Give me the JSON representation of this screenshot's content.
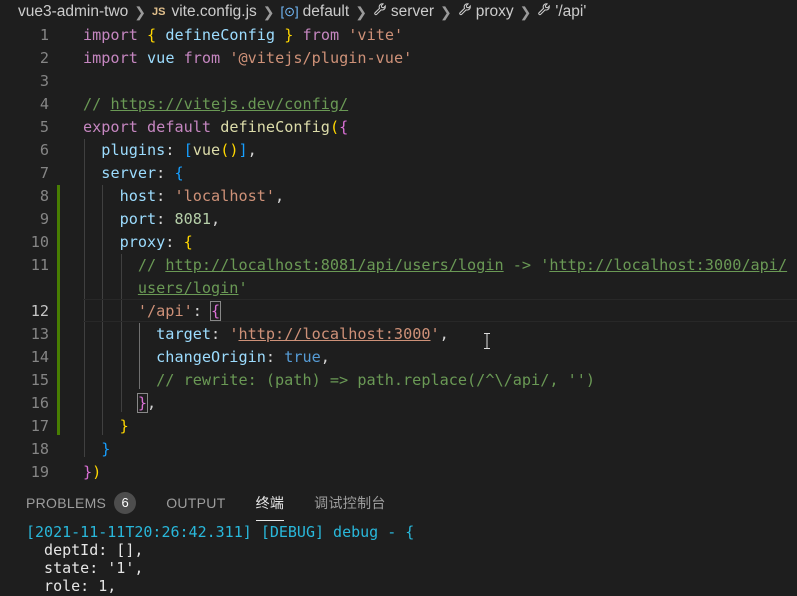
{
  "breadcrumb": {
    "folder": "vue3-admin-two",
    "file_badge": "JS",
    "file": "vite.config.js",
    "symbol1": "default",
    "symbol2": "server",
    "symbol3": "proxy",
    "symbol4": "'/api'",
    "separator": ">"
  },
  "editor": {
    "lines": [
      {
        "n": "1",
        "tokens": [
          [
            "kw",
            "import"
          ],
          [
            "plain",
            " "
          ],
          [
            "br1",
            "{"
          ],
          [
            "plain",
            " "
          ],
          [
            "prop",
            "defineConfig"
          ],
          [
            "plain",
            " "
          ],
          [
            "br1",
            "}"
          ],
          [
            "plain",
            " "
          ],
          [
            "kw",
            "from"
          ],
          [
            "plain",
            " "
          ],
          [
            "str",
            "'vite'"
          ]
        ]
      },
      {
        "n": "2",
        "tokens": [
          [
            "kw",
            "import"
          ],
          [
            "plain",
            " "
          ],
          [
            "prop",
            "vue"
          ],
          [
            "plain",
            " "
          ],
          [
            "kw",
            "from"
          ],
          [
            "plain",
            " "
          ],
          [
            "str",
            "'@vitejs/plugin-vue'"
          ]
        ]
      },
      {
        "n": "3",
        "tokens": []
      },
      {
        "n": "4",
        "tokens": [
          [
            "cm",
            "// "
          ],
          [
            "cm ul",
            "https://vitejs.dev/config/"
          ]
        ]
      },
      {
        "n": "5",
        "tokens": [
          [
            "kw",
            "export"
          ],
          [
            "plain",
            " "
          ],
          [
            "kw",
            "default"
          ],
          [
            "plain",
            " "
          ],
          [
            "fn",
            "defineConfig"
          ],
          [
            "br1",
            "("
          ],
          [
            "br2",
            "{"
          ]
        ]
      },
      {
        "n": "6",
        "tokens": [
          [
            "plain",
            "  "
          ],
          [
            "prop",
            "plugins"
          ],
          [
            "plain",
            ": "
          ],
          [
            "br3",
            "["
          ],
          [
            "fn",
            "vue"
          ],
          [
            "br1",
            "()"
          ],
          [
            "br3",
            "]"
          ],
          [
            "plain",
            ","
          ]
        ]
      },
      {
        "n": "7",
        "tokens": [
          [
            "plain",
            "  "
          ],
          [
            "prop",
            "server"
          ],
          [
            "plain",
            ": "
          ],
          [
            "br3",
            "{"
          ]
        ]
      },
      {
        "n": "8",
        "tokens": [
          [
            "plain",
            "    "
          ],
          [
            "prop",
            "host"
          ],
          [
            "plain",
            ": "
          ],
          [
            "str",
            "'localhost'"
          ],
          [
            "plain",
            ","
          ]
        ]
      },
      {
        "n": "9",
        "tokens": [
          [
            "plain",
            "    "
          ],
          [
            "prop",
            "port"
          ],
          [
            "plain",
            ": "
          ],
          [
            "num",
            "8081"
          ],
          [
            "plain",
            ","
          ]
        ]
      },
      {
        "n": "10",
        "tokens": [
          [
            "plain",
            "    "
          ],
          [
            "prop",
            "proxy"
          ],
          [
            "plain",
            ": "
          ],
          [
            "br1",
            "{"
          ]
        ]
      },
      {
        "n": "11",
        "tokens": [
          [
            "plain",
            "      "
          ],
          [
            "cm",
            "// "
          ],
          [
            "cm ul",
            "http://localhost:8081/api/users/login"
          ],
          [
            "cm",
            " -> '"
          ],
          [
            "cm ul",
            "http://localhost:3000/api/"
          ]
        ]
      },
      {
        "n": "",
        "tokens": [
          [
            "plain",
            "      "
          ],
          [
            "cm ul",
            "users/login"
          ],
          [
            "cm",
            "'"
          ]
        ]
      },
      {
        "n": "12",
        "tokens": [
          [
            "plain",
            "      "
          ],
          [
            "str",
            "'/api'"
          ],
          [
            "plain",
            ": "
          ],
          [
            "br2 matchbr",
            "{"
          ]
        ]
      },
      {
        "n": "13",
        "tokens": [
          [
            "plain",
            "        "
          ],
          [
            "prop",
            "target"
          ],
          [
            "plain",
            ": "
          ],
          [
            "str",
            "'"
          ],
          [
            "str ul",
            "http://localhost:3000"
          ],
          [
            "str",
            "'"
          ],
          [
            "plain",
            ","
          ]
        ]
      },
      {
        "n": "14",
        "tokens": [
          [
            "plain",
            "        "
          ],
          [
            "prop",
            "changeOrigin"
          ],
          [
            "plain",
            ": "
          ],
          [
            "kb",
            "true"
          ],
          [
            "plain",
            ","
          ]
        ]
      },
      {
        "n": "15",
        "tokens": [
          [
            "plain",
            "        "
          ],
          [
            "cm",
            "// rewrite: (path) => path.replace(/^\\/api/, '')"
          ]
        ]
      },
      {
        "n": "16",
        "tokens": [
          [
            "plain",
            "      "
          ],
          [
            "br2 matchbr",
            "}"
          ],
          [
            "plain",
            ","
          ]
        ]
      },
      {
        "n": "17",
        "tokens": [
          [
            "plain",
            "    "
          ],
          [
            "br1",
            "}"
          ]
        ]
      },
      {
        "n": "18",
        "tokens": [
          [
            "plain",
            "  "
          ],
          [
            "br3",
            "}"
          ]
        ]
      },
      {
        "n": "19",
        "tokens": [
          [
            "br2",
            "}"
          ],
          [
            "br1",
            ")"
          ]
        ]
      }
    ],
    "active_line": "12"
  },
  "panel": {
    "tabs": [
      {
        "label": "PROBLEMS",
        "badge": "6"
      },
      {
        "label": "OUTPUT"
      },
      {
        "label": "终端"
      },
      {
        "label": "调试控制台"
      }
    ],
    "active_tab": "终端"
  },
  "terminal": {
    "line1_ts": "[2021-11-11T20:26:42.311]",
    "line1_level": "[DEBUG]",
    "line1_rest": " debug - {",
    "lines": [
      "  deptId: [],",
      "  state: '1',",
      "  role: 1,"
    ]
  },
  "colors": {
    "background": "#1e1e1e",
    "keyword": "#c586c0",
    "string": "#ce9178",
    "property": "#9cdcfe",
    "comment": "#6a9955",
    "function": "#dcdcaa",
    "number": "#b5cea8",
    "git_modified": "#487e02"
  }
}
